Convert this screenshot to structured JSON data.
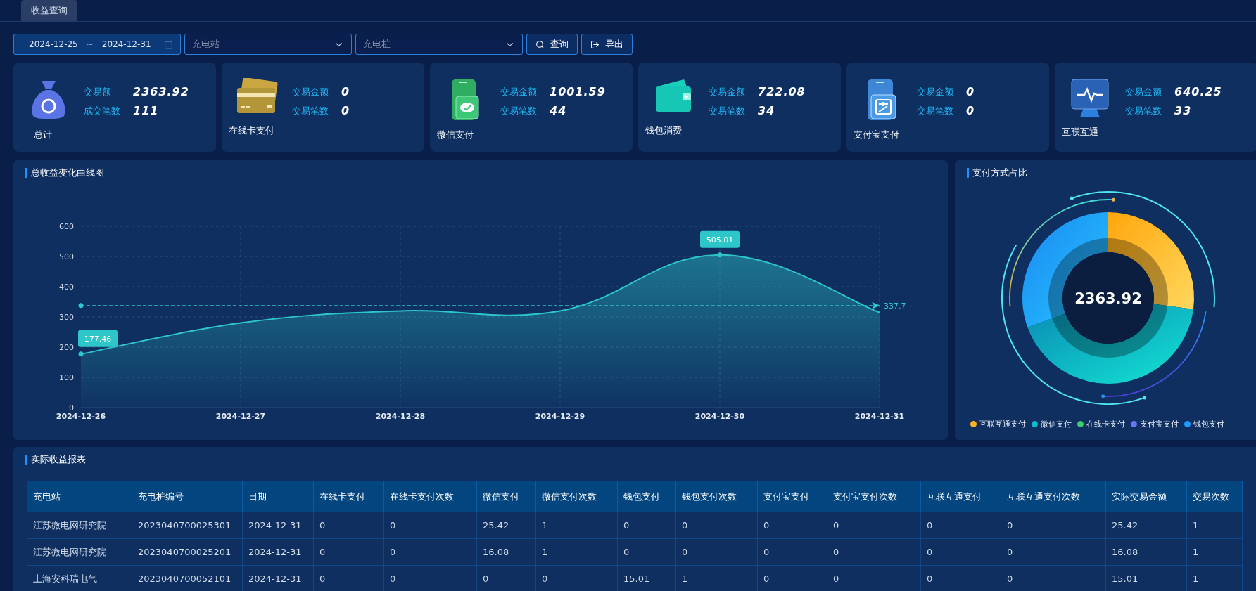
{
  "tabs": [
    {
      "label": "收益查询",
      "selected": true
    }
  ],
  "filters": {
    "start_date": "2024-12-25",
    "separator": "~",
    "end_date": "2024-12-31",
    "station": {
      "placeholder": "充电站"
    },
    "pile": {
      "placeholder": "充电桩"
    },
    "buttons": [
      {
        "kind": "search",
        "label": "查询"
      },
      {
        "kind": "export",
        "label": "导出"
      }
    ]
  },
  "summary_cards": [
    {
      "kind": "total",
      "name": "总计",
      "stats": [
        {
          "label": "交易额",
          "value": "2363.92"
        },
        {
          "label": "成交笔数",
          "value": "111"
        }
      ]
    },
    {
      "kind": "card",
      "name": "在线卡支付",
      "stats": [
        {
          "label": "交易金额",
          "value": "0"
        },
        {
          "label": "交易笔数",
          "value": "0"
        }
      ]
    },
    {
      "kind": "wechat",
      "name": "微信支付",
      "stats": [
        {
          "label": "交易金额",
          "value": "1001.59"
        },
        {
          "label": "交易笔数",
          "value": "44"
        }
      ]
    },
    {
      "kind": "wallet",
      "name": "钱包消费",
      "stats": [
        {
          "label": "交易金额",
          "value": "722.08"
        },
        {
          "label": "交易笔数",
          "value": "34"
        }
      ]
    },
    {
      "kind": "alipay",
      "name": "支付宝支付",
      "stats": [
        {
          "label": "交易金额",
          "value": "0"
        },
        {
          "label": "交易笔数",
          "value": "0"
        }
      ]
    },
    {
      "kind": "interconnect",
      "name": "互联互通",
      "stats": [
        {
          "label": "交易金额",
          "value": "640.25"
        },
        {
          "label": "交易笔数",
          "value": "33"
        }
      ]
    }
  ],
  "trend_panel": {
    "title": "总收益变化曲线图",
    "chart_data": {
      "type": "area",
      "categories": [
        "2024-12-26",
        "2024-12-27",
        "2024-12-28",
        "2024-12-29",
        "2024-12-30",
        "2024-12-31"
      ],
      "series": [
        {
          "color": "#2ec7c9",
          "values": [
            177,
            280,
            320,
            320,
            505,
            315
          ]
        }
      ],
      "ylim": [
        0,
        600
      ],
      "yticks": [
        0,
        100,
        200,
        300,
        400,
        500,
        600
      ],
      "grid": true,
      "annotations": [
        {
          "text": "505.01",
          "x": "2024-12-30",
          "y": 505.01
        },
        {
          "text": "177.46",
          "x": "2024-12-26",
          "y": 177.46
        }
      ],
      "ref_lines": [
        {
          "axis": "y",
          "value": 337.7,
          "label": "337.7"
        }
      ]
    }
  },
  "share_panel": {
    "title": "支付方式占比",
    "center_label": "2363.92",
    "chart_data": {
      "type": "donut",
      "categories": [
        "互联互通支付",
        "微信支付",
        "在线卡支付",
        "支付宝支付",
        "钱包支付"
      ],
      "values": [
        27.08,
        42.37,
        0,
        0,
        30.55
      ],
      "colors": [
        "#ffb31f",
        "#10b9c8",
        "#3fcb6a",
        "#6577f2",
        "#1c9cff"
      ]
    }
  },
  "report_panel": {
    "title": "实际收益报表",
    "table": {
      "columns": [
        "充电站",
        "充电桩编号",
        "日期",
        "在线卡支付",
        "在线卡支付次数",
        "微信支付",
        "微信支付次数",
        "钱包支付",
        "钱包支付次数",
        "支付宝支付",
        "支付宝支付次数",
        "互联互通支付",
        "互联互通支付次数",
        "实际交易金额",
        "交易次数"
      ],
      "rows": [
        [
          "江苏微电网研究院",
          "2023040700025301",
          "2024-12-31",
          "0",
          "0",
          "25.42",
          "1",
          "0",
          "0",
          "0",
          "0",
          "0",
          "0",
          "25.42",
          "1"
        ],
        [
          "江苏微电网研究院",
          "2023040700025201",
          "2024-12-31",
          "0",
          "0",
          "16.08",
          "1",
          "0",
          "0",
          "0",
          "0",
          "0",
          "0",
          "16.08",
          "1"
        ],
        [
          "上海安科瑞电气",
          "2023040700052101",
          "2024-12-31",
          "0",
          "0",
          "0",
          "0",
          "15.01",
          "1",
          "0",
          "0",
          "0",
          "0",
          "15.01",
          "1"
        ]
      ]
    }
  }
}
